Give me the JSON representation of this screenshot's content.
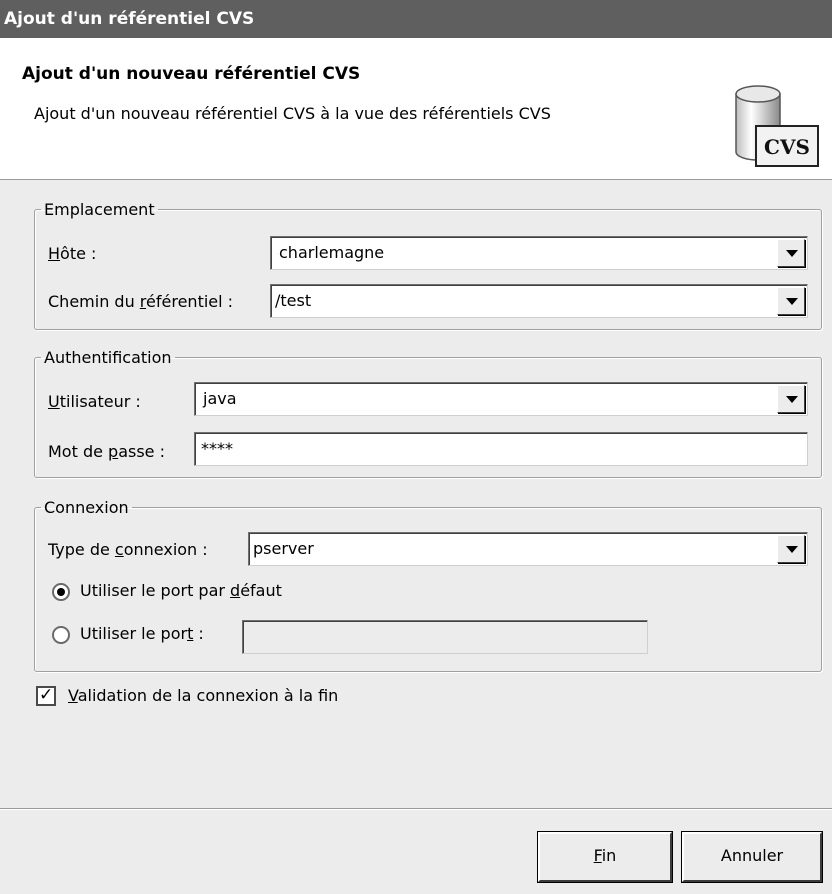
{
  "window": {
    "title": "Ajout d'un référentiel CVS"
  },
  "header": {
    "title": "Ajout d'un nouveau référentiel CVS",
    "description": "Ajout d'un nouveau référentiel CVS à la vue des référentiels CVS",
    "icon": {
      "name": "cvs-repository-icon",
      "label": "CVS"
    }
  },
  "location": {
    "legend": "Emplacement",
    "host": {
      "label": {
        "pre": "",
        "mnemonic": "H",
        "post": "ôte :"
      },
      "value": "charlemagne"
    },
    "path": {
      "label": {
        "pre": "Chemin du ",
        "mnemonic": "r",
        "post": "éférentiel :"
      },
      "value": "/test"
    }
  },
  "auth": {
    "legend": "Authentification",
    "user": {
      "label": {
        "pre": "",
        "mnemonic": "U",
        "post": "tilisateur :"
      },
      "value": "java"
    },
    "password": {
      "label": {
        "pre": "Mot de ",
        "mnemonic": "p",
        "post": "asse :"
      },
      "value": "****"
    }
  },
  "connection": {
    "legend": "Connexion",
    "type": {
      "label": {
        "pre": "Type de ",
        "mnemonic": "c",
        "post": "onnexion :"
      },
      "value": "pserver"
    },
    "default_port": {
      "label": {
        "pre": "Utiliser le port par ",
        "mnemonic": "d",
        "post": "éfaut"
      },
      "selected": true
    },
    "custom_port": {
      "label": {
        "pre": "Utiliser le por",
        "mnemonic": "t",
        "post": " :"
      },
      "selected": false,
      "value": ""
    }
  },
  "validate": {
    "label": {
      "pre": "",
      "mnemonic": "V",
      "post": "alidation de la connexion à la fin"
    },
    "checked": true
  },
  "buttons": {
    "finish": {
      "pre": "",
      "mnemonic": "F",
      "post": "in"
    },
    "cancel": "Annuler"
  },
  "colors": {
    "titlebar": "#5f5f5f",
    "header_bg": "#ffffff",
    "dialog_bg": "#ececec"
  }
}
